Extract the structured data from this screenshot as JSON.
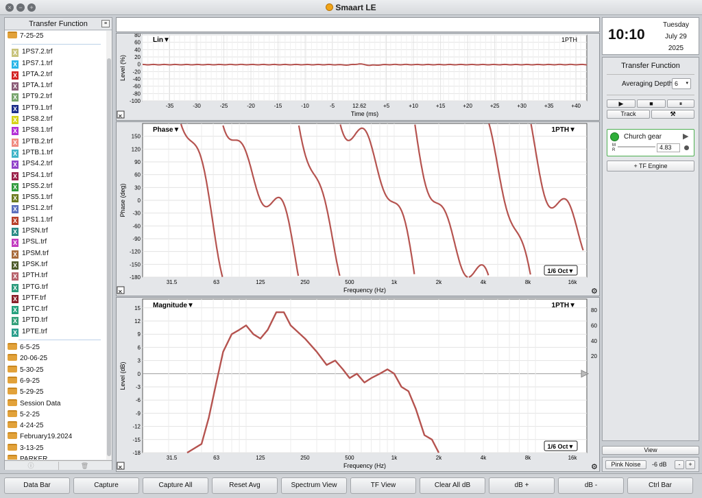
{
  "window": {
    "title": "Smaart LE"
  },
  "left_panel": {
    "title": "Transfer Function",
    "open_folder": "7-25-25",
    "files": [
      {
        "name": "1PS7.2.trf",
        "color": "#c8c37c"
      },
      {
        "name": "1PS7.1.trf",
        "color": "#29b6e8"
      },
      {
        "name": "1PTA.2.trf",
        "color": "#d32222"
      },
      {
        "name": "1PTA.1.trf",
        "color": "#8a5a76"
      },
      {
        "name": "1PT9.2.trf",
        "color": "#76a36a"
      },
      {
        "name": "1PT9.1.trf",
        "color": "#1c2d8a"
      },
      {
        "name": "1PS8.2.trf",
        "color": "#d6d21a"
      },
      {
        "name": "1PS8.1.trf",
        "color": "#b32fd6"
      },
      {
        "name": "1PTB.2.trf",
        "color": "#f08a80"
      },
      {
        "name": "1PTB.1.trf",
        "color": "#3fb4c7"
      },
      {
        "name": "1PS4.2.trf",
        "color": "#9042c9"
      },
      {
        "name": "1PS4.1.trf",
        "color": "#9a1f48"
      },
      {
        "name": "1PS5.2.trf",
        "color": "#2f9a3b"
      },
      {
        "name": "1PS5.1.trf",
        "color": "#6c7a1f"
      },
      {
        "name": "1PS1.2.trf",
        "color": "#5c6fbd"
      },
      {
        "name": "1PS1.1.trf",
        "color": "#b8402a"
      },
      {
        "name": "1PSN.trf",
        "color": "#2a8a85"
      },
      {
        "name": "1PSL.trf",
        "color": "#c23bc0"
      },
      {
        "name": "1PSM.trf",
        "color": "#a86a3a"
      },
      {
        "name": "1PSK.trf",
        "color": "#4d5a2a"
      },
      {
        "name": "1PTH.trf",
        "color": "#b7616a"
      },
      {
        "name": "1PTG.trf",
        "color": "#2b9a7b"
      },
      {
        "name": "1PTF.trf",
        "color": "#8a1f2a"
      },
      {
        "name": "1PTC.trf",
        "color": "#26a17e"
      },
      {
        "name": "1PTD.trf",
        "color": "#34a07a"
      },
      {
        "name": "1PTE.trf",
        "color": "#2a9e8c"
      }
    ],
    "folders": [
      "6-5-25",
      "20-06-25",
      "5-30-25",
      "6-9-25",
      "5-29-25",
      "Session Data",
      "5-2-25",
      "4-24-25",
      "February19.2024",
      "3-13-25",
      "PARKER"
    ]
  },
  "live_plot": {
    "mode": "Lin▼",
    "trace": "1PTH",
    "ylabel": "Level (%)",
    "xlabel": "Time (ms)",
    "y_ticks": [
      "80",
      "60",
      "40",
      "20",
      "0",
      "-20",
      "-40",
      "-60",
      "-80",
      "-100"
    ],
    "x_ticks": [
      "-35",
      "-30",
      "-25",
      "-20",
      "-15",
      "-10",
      "-5",
      "12.62",
      "+5",
      "+10",
      "+15",
      "+20",
      "+25",
      "+30",
      "+35",
      "+40"
    ],
    "close_icon": "✕"
  },
  "phase_plot": {
    "mode": "Phase▼",
    "trace": "1PTH▼",
    "ylabel": "Phase (deg)",
    "xlabel": "Frequency (Hz)",
    "y_ticks": [
      "150",
      "120",
      "90",
      "60",
      "30",
      "0",
      "-30",
      "-60",
      "-90",
      "-120",
      "-150",
      "-180"
    ],
    "x_ticks": [
      "31.5",
      "63",
      "125",
      "250",
      "500",
      "1k",
      "2k",
      "4k",
      "8k",
      "16k"
    ],
    "smoothing": "1/6 Oct▼",
    "close_icon": "✕",
    "gear_icon": "⚙"
  },
  "mag_plot": {
    "mode": "Magnitude▼",
    "trace": "1PTH▼",
    "ylabel": "Level (dB)",
    "xlabel": "Frequency (Hz)",
    "y_ticks": [
      "15",
      "12",
      "9",
      "6",
      "3",
      "0",
      "-3",
      "-6",
      "-9",
      "-12",
      "-15",
      "-18"
    ],
    "y2_ticks": [
      "80",
      "60",
      "40",
      "20"
    ],
    "x_ticks": [
      "31.5",
      "63",
      "125",
      "250",
      "500",
      "1k",
      "2k",
      "4k",
      "8k",
      "16k"
    ],
    "smoothing": "1/6 Oct▼",
    "close_icon": "✕",
    "gear_icon": "⚙"
  },
  "clock": {
    "time": "10:10",
    "weekday": "Tuesday",
    "date": "July 29",
    "year": "2025"
  },
  "right_panel": {
    "title": "Transfer Function",
    "averaging_label": "Averaging Depth:",
    "averaging_value": "6",
    "transport": [
      "▶",
      "■",
      "⏸"
    ],
    "track_label": "Track",
    "tools_icon": "⚒",
    "engine": {
      "name": "Church gear",
      "m_label": "M",
      "r_label": "R",
      "value": "4.83"
    },
    "add_engine": "+ TF Engine",
    "view_label": "View",
    "pink_noise": "Pink Noise",
    "pink_level": "-6 dB",
    "minus": "-",
    "plus": "+"
  },
  "bottom_buttons": [
    "Data Bar",
    "Capture",
    "Capture All",
    "Reset Avg",
    "Spectrum View",
    "TF View",
    "Clear All dB",
    "dB +",
    "dB -",
    "Ctrl Bar"
  ],
  "colors": {
    "trace": "#b5534f",
    "grid": "#e3e3e3",
    "accent_green": "#2fae3a",
    "folder": "#e2a23a"
  },
  "chart_data": [
    {
      "type": "line",
      "title": "",
      "xlabel": "Time (ms)",
      "ylabel": "Level (%)",
      "ylim": [
        -100,
        80
      ],
      "xlim": [
        -40,
        42
      ],
      "series": [
        {
          "name": "1PTH",
          "x": [
            -40,
            -30,
            -20,
            -10,
            -5,
            -2,
            0,
            2,
            5,
            10,
            20,
            30,
            42
          ],
          "y": [
            -1,
            -1,
            -1,
            -1,
            -1,
            -2,
            1,
            -3,
            -1,
            -1,
            -1,
            -1,
            -1
          ]
        }
      ]
    },
    {
      "type": "line",
      "title": "",
      "xlabel": "Frequency (Hz)",
      "ylabel": "Phase (deg)",
      "ylim": [
        -180,
        180
      ],
      "x_scale": "log",
      "series": [
        {
          "name": "1PTH",
          "x": [
            40,
            44,
            50,
            56,
            63,
            70,
            80,
            90,
            100,
            112,
            125,
            140,
            160,
            180,
            200,
            220
          ],
          "y": [
            80,
            20,
            -40,
            -90,
            -130,
            -175,
            100,
            60,
            20,
            -20,
            -60,
            -90,
            -120,
            -140,
            -150,
            -175
          ]
        }
      ]
    },
    {
      "type": "line",
      "title": "",
      "xlabel": "Frequency (Hz)",
      "ylabel": "Level (dB)",
      "ylim": [
        -18,
        17
      ],
      "x_scale": "log",
      "series": [
        {
          "name": "1PTH",
          "x": [
            40,
            50,
            56,
            63,
            70,
            80,
            90,
            100,
            112,
            125,
            140,
            160,
            180,
            200,
            250,
            300,
            350,
            400,
            450,
            500,
            560,
            630,
            700,
            800,
            900,
            1000,
            1120,
            1250,
            1400,
            1600,
            1800,
            2000
          ],
          "y": [
            -18,
            -16,
            -10,
            -2,
            5,
            9,
            10,
            11,
            9,
            8,
            10,
            14,
            14,
            11,
            8,
            5,
            2,
            3,
            1,
            -1,
            0,
            -2,
            -1,
            0,
            1,
            0,
            -3,
            -4,
            -8,
            -14,
            -15,
            -18
          ]
        }
      ]
    }
  ]
}
